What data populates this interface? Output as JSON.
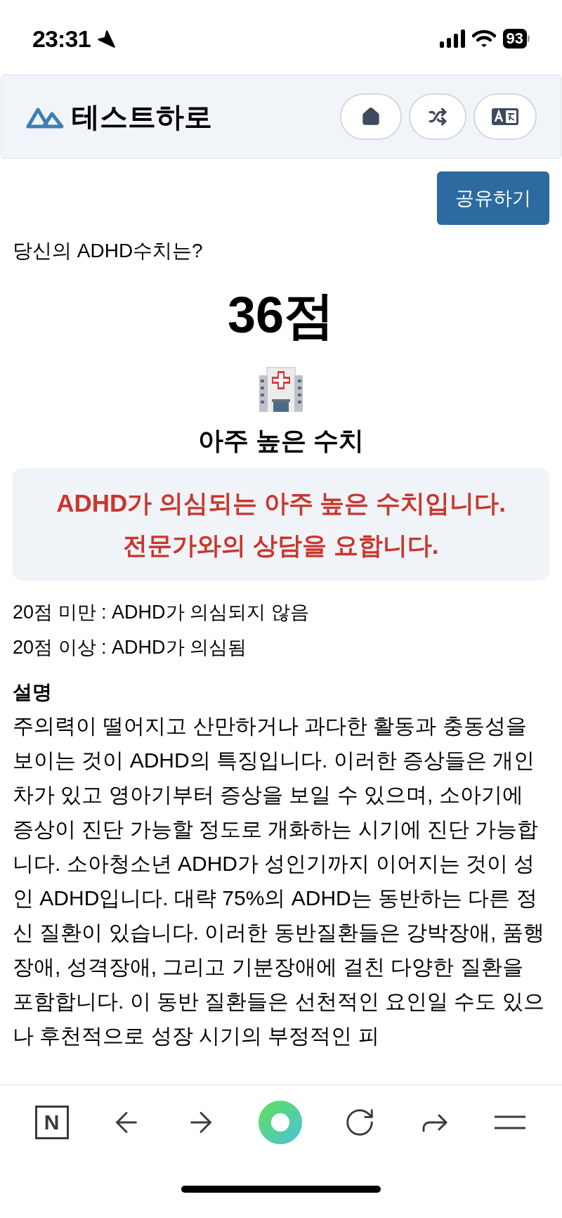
{
  "status_bar": {
    "time": "23:31",
    "battery": "93"
  },
  "header": {
    "logo_text": "테스트하로"
  },
  "share_button": "공유하기",
  "question": "당신의 ADHD수치는?",
  "score": "36점",
  "level_title": "아주 높은 수치",
  "alert": {
    "lines": [
      "ADHD가 의심되는 아주 높은 수치입니다.",
      "전문가와의 상담을 요합니다."
    ]
  },
  "ranges": [
    "20점 미만 : ADHD가 의심되지 않음",
    "20점 이상 : ADHD가 의심됨"
  ],
  "description": {
    "title": "설명",
    "text": "주의력이 떨어지고 산만하거나 과다한 활동과 충동성을 보이는 것이 ADHD의 특징입니다. 이러한 증상들은 개인차가 있고 영아기부터 증상을 보일 수 있으며, 소아기에 증상이 진단 가능할 정도로 개화하는 시기에 진단 가능합니다. 소아청소년 ADHD가 성인기까지 이어지는 것이 성인 ADHD입니다. 대략 75%의 ADHD는 동반하는 다른 정신 질환이 있습니다. 이러한 동반질환들은 강박장애, 품행장애, 성격장애, 그리고 기분장애에 걸친 다양한 질환을 포함합니다. 이 동반 질환들은 선천적인 요인일 수도 있으나 후천적으로 성장 시기의 부정적인 피"
  },
  "browser_toolbar": {
    "logo_letter": "N"
  }
}
